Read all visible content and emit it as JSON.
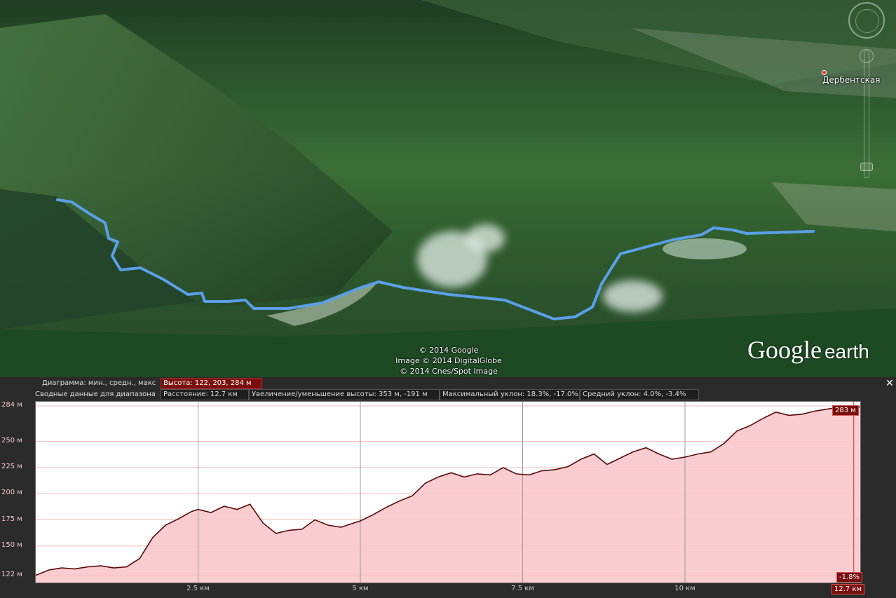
{
  "map": {
    "copyright": [
      "© 2014 Google",
      "Image © 2014 DigitalGlobe",
      "© 2014 Cnes/Spot Image"
    ],
    "place_label": "Дербентская",
    "brand_main": "Google",
    "brand_sub": "earth",
    "colors": {
      "track": "#5aa0e8",
      "terrain": "#2f5b2d"
    }
  },
  "panel": {
    "chart_label": "Диаграмма: мин., средн., макс",
    "chart_value": "Высота: 122, 203, 284 м",
    "summary_label": "Сводные данные для диапазона",
    "distance": "Расстояние: 12.7 км",
    "gain_loss": "Увеличение/уменьшение высоты: 353 м, -191 м",
    "max_slope": "Максимальный уклон: 18.3%, -17.0%",
    "avg_slope": "Средний уклон: 4.0%, -3.4%",
    "close_icon": "close-icon",
    "cursor_elevation": "283 м",
    "cursor_slope": "-1.8%",
    "cursor_distance": "12.7 км"
  },
  "chart_data": {
    "type": "area",
    "xlabel": "",
    "ylabel": "",
    "xlim": [
      0,
      12.7
    ],
    "ylim": [
      115,
      288
    ],
    "x_ticks": [
      2.5,
      5,
      7.5,
      10
    ],
    "x_tick_labels": [
      "2.5 км",
      "5 км",
      "7.5 км",
      "10 км"
    ],
    "y_ticks": [
      122,
      150,
      175,
      200,
      225,
      250,
      284
    ],
    "y_tick_labels": [
      "122 м",
      "150 м",
      "175 м",
      "200 м",
      "225 м",
      "250 м",
      "284 м"
    ],
    "colors": {
      "fill": "#f8c4c8",
      "line": "#5a0a0a"
    },
    "series": [
      {
        "x": [
          0,
          0.2,
          0.4,
          0.6,
          0.8,
          1.0,
          1.2,
          1.4,
          1.6,
          1.8,
          2.0,
          2.2,
          2.4,
          2.5,
          2.7,
          2.9,
          3.1,
          3.3,
          3.5,
          3.7,
          3.9,
          4.1,
          4.3,
          4.5,
          4.7,
          4.9,
          5.0,
          5.2,
          5.4,
          5.6,
          5.8,
          6.0,
          6.2,
          6.4,
          6.6,
          6.8,
          7.0,
          7.2,
          7.4,
          7.6,
          7.8,
          8.0,
          8.2,
          8.4,
          8.6,
          8.8,
          9.0,
          9.2,
          9.4,
          9.6,
          9.8,
          10.0,
          10.2,
          10.4,
          10.6,
          10.8,
          11.0,
          11.2,
          11.4,
          11.6,
          11.8,
          12.0,
          12.2,
          12.4,
          12.6,
          12.7
        ],
        "y": [
          122,
          127,
          129,
          128,
          130,
          131,
          129,
          130,
          138,
          158,
          170,
          176,
          183,
          185,
          182,
          188,
          185,
          190,
          172,
          162,
          165,
          166,
          175,
          170,
          168,
          172,
          174,
          180,
          187,
          193,
          198,
          210,
          216,
          220,
          216,
          219,
          218,
          225,
          219,
          218,
          222,
          223,
          226,
          233,
          238,
          228,
          234,
          240,
          244,
          238,
          233,
          235,
          238,
          240,
          248,
          260,
          265,
          272,
          278,
          275,
          276,
          279,
          281,
          283,
          283,
          283
        ]
      }
    ]
  }
}
